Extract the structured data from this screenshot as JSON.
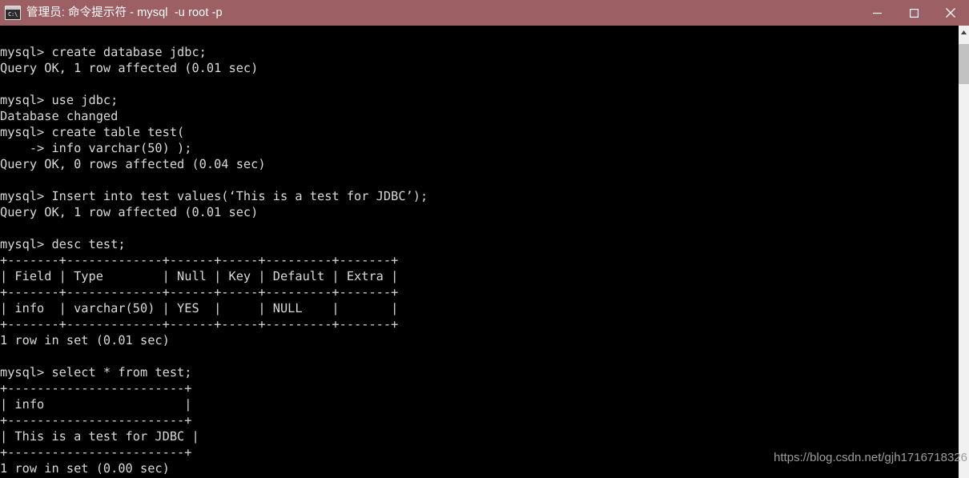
{
  "window": {
    "title": "管理员: 命令提示符 - mysql  -u root -p",
    "icon_name": "cmd-console-icon",
    "icon_text": "C:\\",
    "titlebar_color": "#9b5f64",
    "background_color": "#000000",
    "text_color": "#d9d9d9"
  },
  "controls": {
    "minimize_label": "Minimize",
    "maximize_label": "Maximize",
    "close_label": "Close"
  },
  "scrollbar": {
    "up_arrow_label": "Scroll up",
    "thumb_label": "Scroll thumb"
  },
  "terminal": {
    "prompt": "mysql>",
    "content": "mysql> create database jdbc;\nQuery OK, 1 row affected (0.01 sec)\n\nmysql> use jdbc;\nDatabase changed\nmysql> create table test(\n    -> info varchar(50) );\nQuery OK, 0 rows affected (0.04 sec)\n\nmysql> Insert into test values(‘This is a test for JDBC’);\nQuery OK, 1 row affected (0.01 sec)\n\nmysql> desc test;\n+-------+-------------+------+-----+---------+-------+\n| Field | Type        | Null | Key | Default | Extra |\n+-------+-------------+------+-----+---------+-------+\n| info  | varchar(50) | YES  |     | NULL    |       |\n+-------+-------------+------+-----+---------+-------+\n1 row in set (0.01 sec)\n\nmysql> select * from test;\n+------------------------+\n| info                   |\n+------------------------+\n| This is a test for JDBC |\n+------------------------+\n1 row in set (0.00 sec)",
    "lines": [
      "mysql> create database jdbc;",
      "Query OK, 1 row affected (0.01 sec)",
      "",
      "mysql> use jdbc;",
      "Database changed",
      "mysql> create table test(",
      "    -> info varchar(50) );",
      "Query OK, 0 rows affected (0.04 sec)",
      "",
      "mysql> Insert into test values(‘This is a test for JDBC’);",
      "Query OK, 1 row affected (0.01 sec)",
      "",
      "mysql> desc test;",
      "+-------+-------------+------+-----+---------+-------+",
      "| Field | Type        | Null | Key | Default | Extra |",
      "+-------+-------------+------+-----+---------+-------+",
      "| info  | varchar(50) | YES  |     | NULL    |       |",
      "+-------+-------------+------+-----+---------+-------+",
      "1 row in set (0.01 sec)",
      "",
      "mysql> select * from test;",
      "+------------------------+",
      "| info                   |",
      "+------------------------+",
      "| This is a test for JDBC |",
      "+------------------------+",
      "1 row in set (0.00 sec)"
    ],
    "commands": [
      "create database jdbc;",
      "use jdbc;",
      "create table test(",
      "    -> info varchar(50) );",
      "Insert into test values(‘This is a test for JDBC’);",
      "desc test;",
      "select * from test;"
    ],
    "results": [
      "Query OK, 1 row affected (0.01 sec)",
      "Database changed",
      "Query OK, 0 rows affected (0.04 sec)",
      "Query OK, 1 row affected (0.01 sec)",
      "1 row in set (0.01 sec)",
      "1 row in set (0.00 sec)"
    ],
    "desc_table": {
      "headers": [
        "Field",
        "Type",
        "Null",
        "Key",
        "Default",
        "Extra"
      ],
      "rows": [
        [
          "info",
          "varchar(50)",
          "YES",
          "",
          "NULL",
          ""
        ]
      ],
      "footer": "1 row in set (0.01 sec)"
    },
    "select_table": {
      "headers": [
        "info"
      ],
      "rows": [
        [
          "This is a test for JDBC"
        ]
      ],
      "footer": "1 row in set (0.00 sec)"
    }
  },
  "watermark": {
    "text": "https://blog.csdn.net/gjh1716718326"
  }
}
